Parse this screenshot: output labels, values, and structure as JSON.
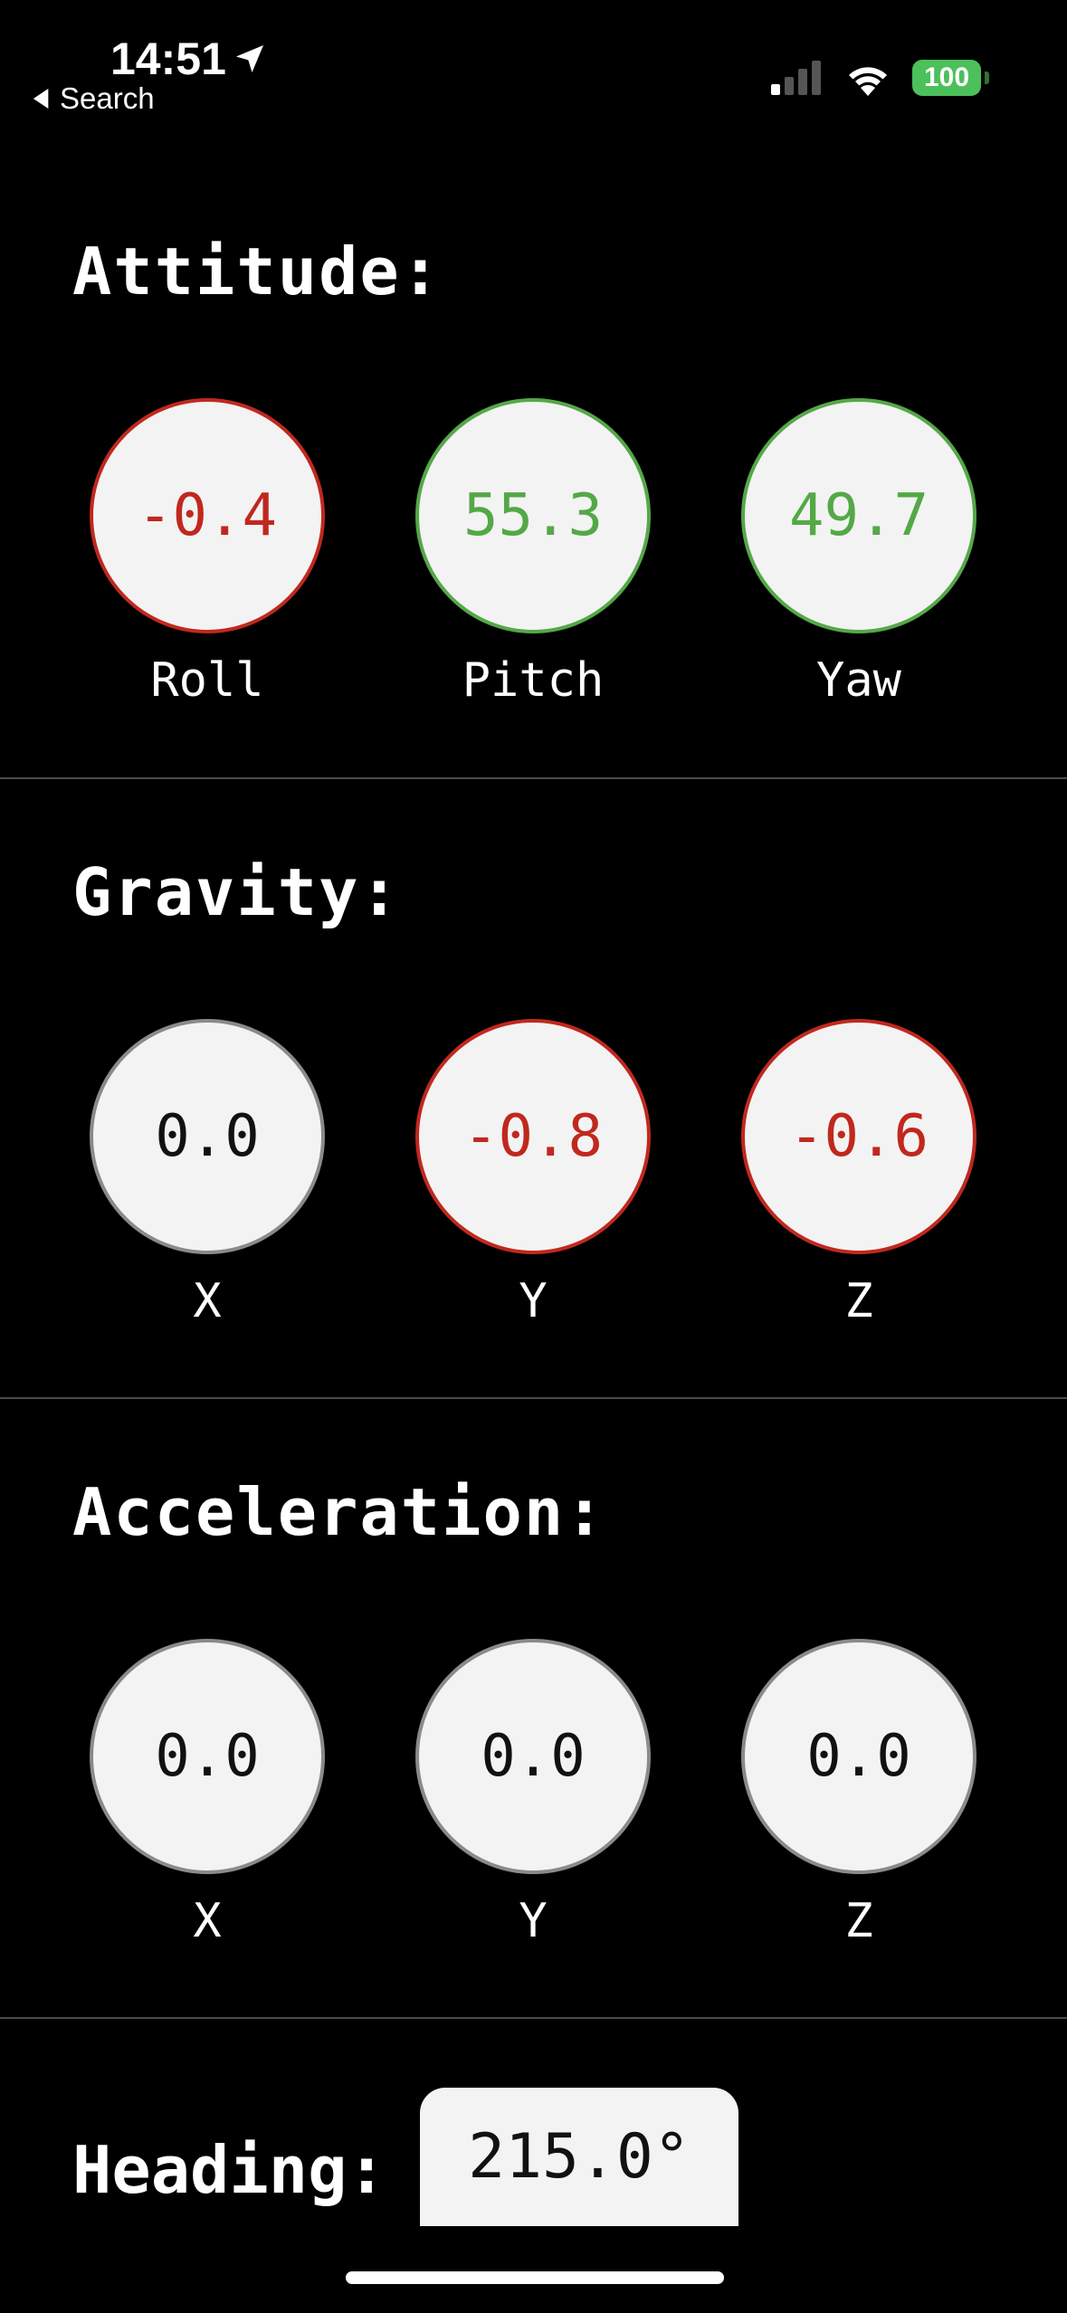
{
  "status_bar": {
    "time": "14:51",
    "back_label": "Search",
    "battery": "100"
  },
  "attitude": {
    "title": "Attitude:",
    "gauges": [
      {
        "label": "Roll",
        "value": "-0.4",
        "state": "negative"
      },
      {
        "label": "Pitch",
        "value": "55.3",
        "state": "positive"
      },
      {
        "label": "Yaw",
        "value": "49.7",
        "state": "positive"
      }
    ]
  },
  "gravity": {
    "title": "Gravity:",
    "gauges": [
      {
        "label": "X",
        "value": "0.0",
        "state": "neutral"
      },
      {
        "label": "Y",
        "value": "-0.8",
        "state": "negative"
      },
      {
        "label": "Z",
        "value": "-0.6",
        "state": "negative"
      }
    ]
  },
  "acceleration": {
    "title": "Acceleration:",
    "gauges": [
      {
        "label": "X",
        "value": "0.0",
        "state": "neutral"
      },
      {
        "label": "Y",
        "value": "0.0",
        "state": "neutral"
      },
      {
        "label": "Z",
        "value": "0.0",
        "state": "neutral"
      }
    ]
  },
  "heading": {
    "title": "Heading:",
    "value": "215.0°"
  },
  "colors": {
    "negative": "#c0281e",
    "positive": "#54a847",
    "neutral": "#8a8a8a",
    "battery": "#4cc05a"
  }
}
